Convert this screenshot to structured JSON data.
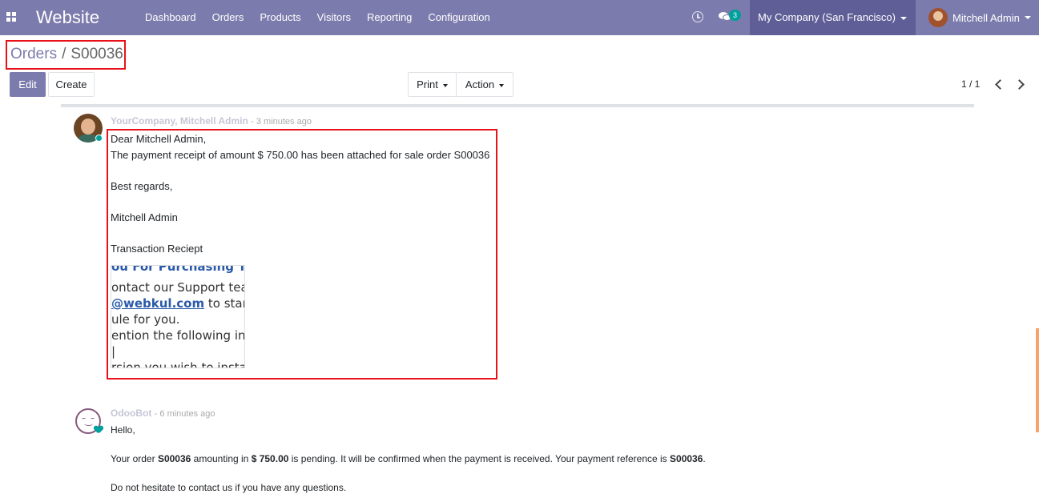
{
  "navbar": {
    "brand": "Website",
    "menu": [
      "Dashboard",
      "Orders",
      "Products",
      "Visitors",
      "Reporting",
      "Configuration"
    ],
    "chat_count": "3",
    "company": "My Company (San Francisco)",
    "user": "Mitchell Admin"
  },
  "breadcrumb": {
    "parent": "Orders",
    "separator": "/",
    "current": "S00036"
  },
  "buttons": {
    "edit": "Edit",
    "create": "Create",
    "print": "Print",
    "action": "Action"
  },
  "pager": {
    "value": "1 / 1"
  },
  "messages": [
    {
      "author": "YourCompany, Mitchell Admin",
      "time": "- 3 minutes ago",
      "lines": [
        "Dear Mitchell Admin,",
        "The payment receipt of amount $ 750.00 has been attached for sale order S00036",
        "Best regards,",
        "Mitchell Admin",
        "Transaction Reciept"
      ],
      "attachment_lines": [
        "ou For Purchasing Th",
        "ontact our Support team",
        "@webkul.com",
        " to start the",
        "ule for you.",
        "ention the following in yo",
        "|",
        "rsion you wish to install"
      ]
    },
    {
      "author": "OdooBot",
      "time": "- 6 minutes ago",
      "greeting": "Hello,",
      "order_prefix": "Your order ",
      "order_ref": "S00036",
      "order_mid": " amounting in ",
      "order_amount": "$ 750.00",
      "order_mid2": " is pending. It will be confirmed when the payment is received. Your payment reference is ",
      "order_ref2": "S00036",
      "order_suffix": ".",
      "closing": "Do not hesitate to contact us if you have any questions."
    }
  ],
  "colors": {
    "navbar": "#7c7bad",
    "company_bg": "#5f5e97",
    "accent": "#00a09d",
    "highlight": "#e8111a"
  }
}
